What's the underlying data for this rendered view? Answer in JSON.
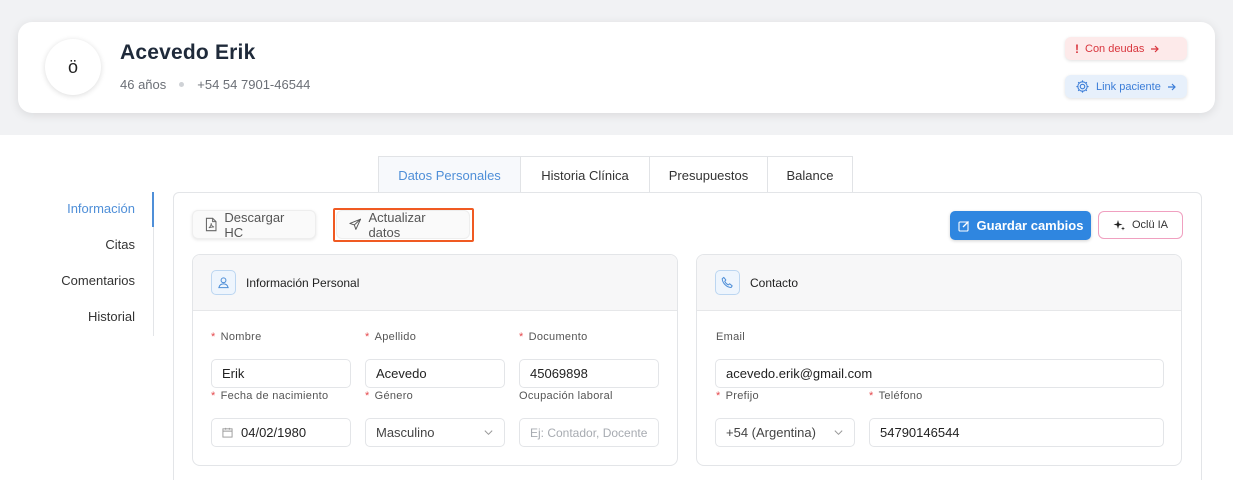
{
  "patient": {
    "avatar_initial": "ö",
    "name": "Acevedo Erik",
    "age": "46 años",
    "phone": "+54 54 7901-46544",
    "debt_label": "Con deudas",
    "link_label": "Link paciente"
  },
  "tabs": [
    "Datos Personales",
    "Historia Clínica",
    "Presupuestos",
    "Balance"
  ],
  "side_nav": [
    "Información",
    "Citas",
    "Comentarios",
    "Historial"
  ],
  "toolbar": {
    "download_label": "Descargar HC",
    "update_label": "Actualizar datos",
    "save_label": "Guardar cambios",
    "ai_label": "Oclü IA"
  },
  "personal": {
    "title": "Información Personal",
    "nombre_label": "Nombre",
    "nombre_value": "Erik",
    "apellido_label": "Apellido",
    "apellido_value": "Acevedo",
    "documento_label": "Documento",
    "documento_value": "45069898",
    "nacimiento_label": "Fecha de nacimiento",
    "nacimiento_value": "04/02/1980",
    "genero_label": "Género",
    "genero_value": "Masculino",
    "ocupacion_label": "Ocupación laboral",
    "ocupacion_placeholder": "Ej: Contador, Docente"
  },
  "contact": {
    "title": "Contacto",
    "email_label": "Email",
    "email_value": "acevedo.erik@gmail.com",
    "prefijo_label": "Prefijo",
    "prefijo_value": "+54 (Argentina)",
    "telefono_label": "Teléfono",
    "telefono_value": "54790146544"
  },
  "colors": {
    "accent": "#2f86e0",
    "tab_active": "#4f8fd8",
    "danger": "#d9363e",
    "highlight": "#f05a22"
  }
}
